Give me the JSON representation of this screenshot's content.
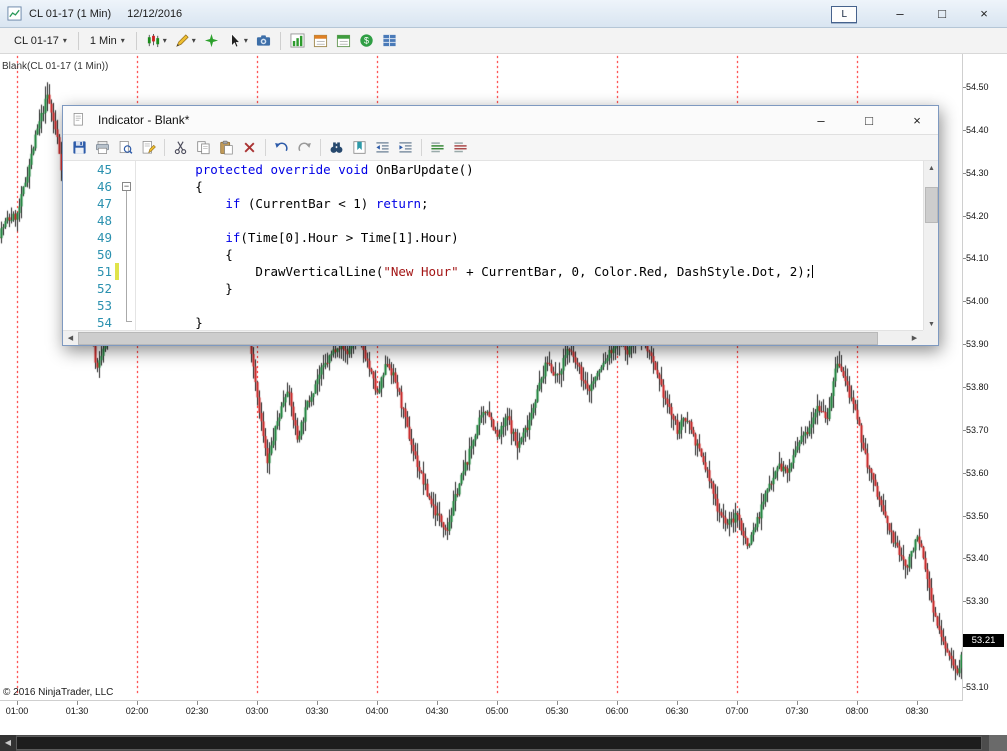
{
  "window": {
    "title": "CL 01-17 (1 Min)",
    "date": "12/12/2016",
    "link_button": "L",
    "controls": {
      "minimize": "–",
      "maximize": "□",
      "close": "×"
    }
  },
  "toolbar": {
    "instrument": "CL 01-17",
    "interval": "1 Min",
    "dropdown_glyph": "▾",
    "icons": [
      {
        "name": "chart-style-button",
        "kind": "candles",
        "dropdown": true
      },
      {
        "name": "drawing-tools-button",
        "kind": "pencil",
        "dropdown": true
      },
      {
        "name": "snap-mode-button",
        "kind": "snap"
      },
      {
        "name": "cursor-button",
        "kind": "cursor",
        "dropdown": true
      },
      {
        "name": "chart-snapshot-button",
        "kind": "camera"
      },
      {
        "sep": true
      },
      {
        "name": "indicators-button",
        "kind": "indicators"
      },
      {
        "name": "data-grid-button",
        "kind": "calendar-orange"
      },
      {
        "name": "session-grid-button",
        "kind": "calendar-green"
      },
      {
        "name": "account-button",
        "kind": "dollar"
      },
      {
        "name": "market-analyzer-button",
        "kind": "grid-blue"
      }
    ]
  },
  "chart": {
    "label": "Blank(CL 01-17 (1 Min))",
    "copyright": "© 2016 NinjaTrader, LLC",
    "price_marker": "53.21"
  },
  "scrollbar": {
    "left_arrow": "◀"
  },
  "editor": {
    "title": "Indicator - Blank*",
    "controls": {
      "minimize": "–",
      "maximize": "□",
      "close": "×"
    },
    "scroll": {
      "up": "▲",
      "down": "▼",
      "left": "◀",
      "right": "▶"
    },
    "toolbar_icons": [
      {
        "name": "save-button",
        "kind": "save"
      },
      {
        "name": "print-button",
        "kind": "print"
      },
      {
        "name": "print-preview-button",
        "kind": "preview"
      },
      {
        "name": "properties-button",
        "kind": "properties"
      },
      {
        "sep": true
      },
      {
        "name": "cut-button",
        "kind": "cut"
      },
      {
        "name": "copy-button",
        "kind": "copy"
      },
      {
        "name": "paste-button",
        "kind": "paste"
      },
      {
        "name": "delete-button",
        "kind": "delete"
      },
      {
        "sep": true
      },
      {
        "name": "undo-button",
        "kind": "undo"
      },
      {
        "name": "redo-button",
        "kind": "redo"
      },
      {
        "sep": true
      },
      {
        "name": "find-button",
        "kind": "find"
      },
      {
        "name": "bookmark-button",
        "kind": "bookmark"
      },
      {
        "name": "outdent-button",
        "kind": "outdent"
      },
      {
        "name": "indent-button",
        "kind": "indent"
      },
      {
        "sep": true
      },
      {
        "name": "comment-button",
        "kind": "comment"
      },
      {
        "name": "uncomment-button",
        "kind": "uncomment"
      }
    ],
    "code": {
      "lines": [
        {
          "num": "45",
          "parts": [
            [
              "p",
              "        "
            ],
            [
              "k",
              "protected"
            ],
            [
              "p",
              " "
            ],
            [
              "k",
              "override"
            ],
            [
              "p",
              " "
            ],
            [
              "k",
              "void"
            ],
            [
              "p",
              " OnBarUpdate()"
            ]
          ]
        },
        {
          "num": "46",
          "fold": true,
          "parts": [
            [
              "p",
              "        {"
            ]
          ]
        },
        {
          "num": "47",
          "parts": [
            [
              "p",
              "            "
            ],
            [
              "k",
              "if"
            ],
            [
              "p",
              " (CurrentBar < 1) "
            ],
            [
              "k",
              "return"
            ],
            [
              "p",
              ";"
            ]
          ]
        },
        {
          "num": "48",
          "parts": []
        },
        {
          "num": "49",
          "parts": [
            [
              "p",
              "            "
            ],
            [
              "k",
              "if"
            ],
            [
              "p",
              "(Time[0].Hour > Time[1].Hour)"
            ]
          ]
        },
        {
          "num": "50",
          "parts": [
            [
              "p",
              "            {"
            ]
          ]
        },
        {
          "num": "51",
          "changed": true,
          "caret": true,
          "parts": [
            [
              "p",
              "                DrawVerticalLine("
            ],
            [
              "s",
              "\"New Hour\""
            ],
            [
              "p",
              " + CurrentBar, 0, Color.Red, DashStyle.Dot, 2);"
            ]
          ]
        },
        {
          "num": "52",
          "parts": [
            [
              "p",
              "            }"
            ]
          ]
        },
        {
          "num": "53",
          "parts": []
        },
        {
          "num": "54",
          "parts": [
            [
              "p",
              "        }"
            ]
          ]
        }
      ]
    }
  },
  "chart_data": {
    "type": "candlestick",
    "symbol": "CL 01-17",
    "interval": "1 Min",
    "date": "12/12/2016",
    "ylim": [
      53.1,
      54.5
    ],
    "y_tick": 0.1,
    "y_tick_labels": [
      "54.50",
      "54.40",
      "54.30",
      "54.20",
      "54.10",
      "54.00",
      "53.90",
      "53.80",
      "53.70",
      "53.60",
      "53.50",
      "53.40",
      "53.30",
      "53.20",
      "53.10"
    ],
    "x_tick_labels": [
      "01:00",
      "01:30",
      "02:00",
      "02:30",
      "03:00",
      "03:30",
      "04:00",
      "04:30",
      "05:00",
      "05:30",
      "06:00",
      "06:30",
      "07:00",
      "07:30",
      "08:00",
      "08:30"
    ],
    "hour_lines": [
      "01:00",
      "02:00",
      "03:00",
      "04:00",
      "05:00",
      "06:00",
      "07:00",
      "08:00"
    ],
    "hour_line_color": "#ff0000",
    "hour_line_style": "dot",
    "up_color": "#0e7a2e",
    "down_color": "#c41616",
    "last_price": 53.21,
    "start_offset_minutes": -10,
    "sample_minutes": 5,
    "close_path": [
      54.15,
      54.19,
      54.2,
      54.3,
      54.4,
      54.48,
      54.38,
      54.22,
      54.12,
      53.96,
      53.84,
      53.92,
      54.02,
      54.06,
      54.1,
      54.05,
      54.12,
      54.08,
      54.0,
      54.04,
      53.98,
      54.05,
      54.0,
      53.96,
      53.94,
      53.96,
      53.78,
      53.62,
      53.72,
      53.8,
      53.68,
      53.76,
      53.82,
      53.86,
      53.9,
      53.88,
      53.93,
      53.86,
      53.78,
      53.86,
      53.8,
      53.7,
      53.62,
      53.55,
      53.5,
      53.47,
      53.56,
      53.63,
      53.71,
      53.75,
      53.68,
      53.73,
      53.66,
      53.71,
      53.79,
      53.86,
      53.82,
      53.89,
      53.85,
      53.79,
      53.83,
      53.87,
      53.91,
      53.88,
      53.93,
      53.89,
      53.82,
      53.76,
      53.7,
      53.73,
      53.66,
      53.6,
      53.52,
      53.48,
      53.5,
      53.43,
      53.49,
      53.56,
      53.62,
      53.6,
      53.66,
      53.7,
      53.76,
      53.73,
      53.86,
      53.8,
      53.72,
      53.62,
      53.55,
      53.48,
      53.42,
      53.38,
      53.46,
      53.35,
      53.24,
      53.18,
      53.14,
      53.21
    ]
  }
}
